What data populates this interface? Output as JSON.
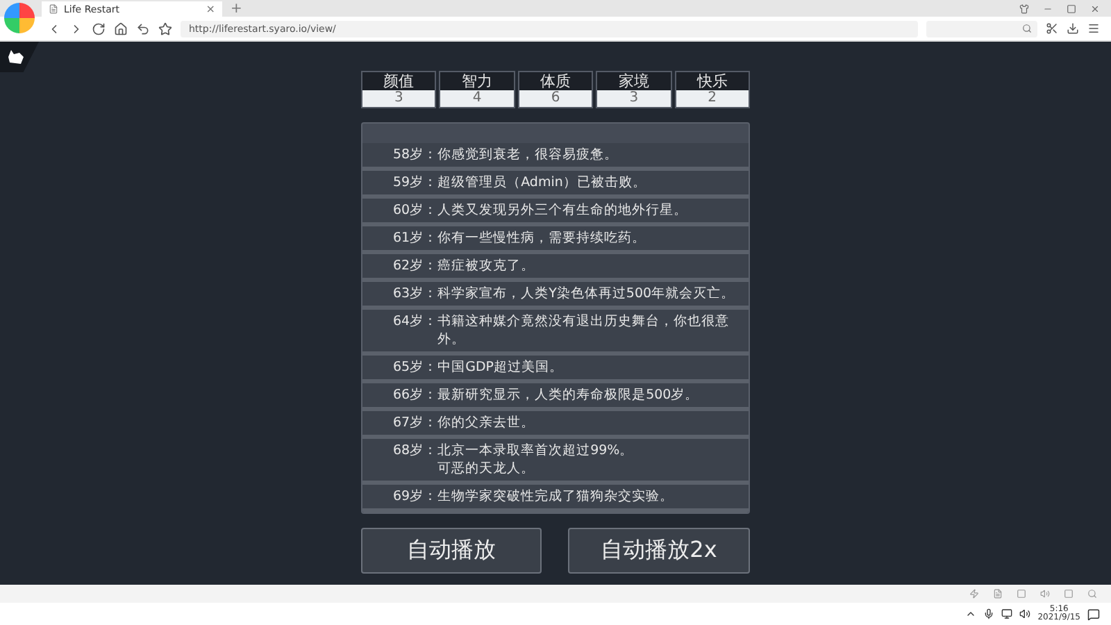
{
  "browser": {
    "tab_title": "Life Restart",
    "tab_close": "×",
    "new_tab": "+",
    "url": "http://liferestart.syaro.io/view/"
  },
  "stats": [
    {
      "label": "颜值",
      "value": "3"
    },
    {
      "label": "智力",
      "value": "4"
    },
    {
      "label": "体质",
      "value": "6"
    },
    {
      "label": "家境",
      "value": "3"
    },
    {
      "label": "快乐",
      "value": "2"
    }
  ],
  "events": [
    {
      "age": "58岁：",
      "lines": [
        "你感觉到衰老，很容易疲惫。"
      ]
    },
    {
      "age": "59岁：",
      "lines": [
        "超级管理员（Admin）已被击败。"
      ]
    },
    {
      "age": "60岁：",
      "lines": [
        "人类又发现另外三个有生命的地外行星。"
      ]
    },
    {
      "age": "61岁：",
      "lines": [
        "你有一些慢性病，需要持续吃药。"
      ]
    },
    {
      "age": "62岁：",
      "lines": [
        "癌症被攻克了。"
      ]
    },
    {
      "age": "63岁：",
      "lines": [
        "科学家宣布，人类Y染色体再过500年就会灭亡。"
      ]
    },
    {
      "age": "64岁：",
      "lines": [
        "书籍这种媒介竟然没有退出历史舞台，你也很意外。"
      ]
    },
    {
      "age": "65岁：",
      "lines": [
        "中国GDP超过美国。"
      ]
    },
    {
      "age": "66岁：",
      "lines": [
        "最新研究显示，人类的寿命极限是500岁。"
      ]
    },
    {
      "age": "67岁：",
      "lines": [
        "你的父亲去世。"
      ]
    },
    {
      "age": "68岁：",
      "lines": [
        "北京一本录取率首次超过99%。",
        "可恶的天龙人。"
      ]
    },
    {
      "age": "69岁：",
      "lines": [
        "生物学家突破性完成了猫狗杂交实验。"
      ]
    }
  ],
  "buttons": [
    "自动播放",
    "自动播放2x"
  ],
  "taskbar": {
    "time": "5:16",
    "date": "2021/9/15"
  }
}
